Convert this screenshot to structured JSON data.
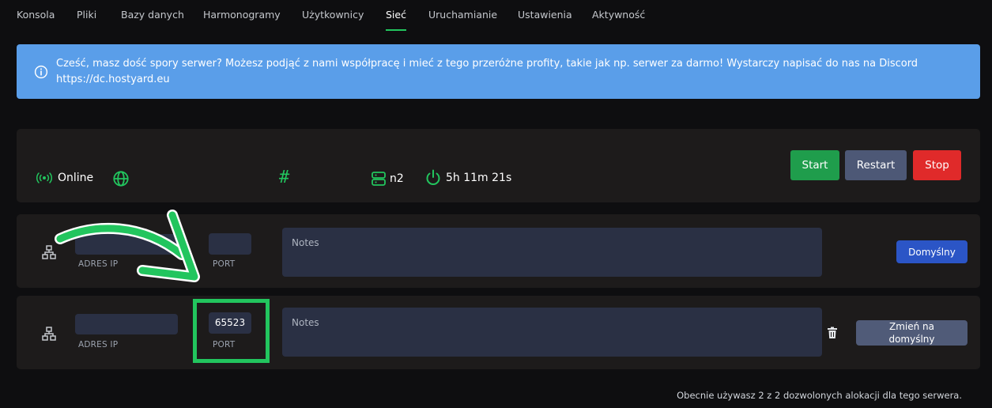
{
  "nav": {
    "items": [
      "Konsola",
      "Pliki",
      "Bazy danych",
      "Harmonogramy",
      "Użytkownicy",
      "Sieć",
      "Uruchamianie",
      "Ustawienia",
      "Aktywność"
    ],
    "active": "Sieć",
    "accent_color": "#22c55e"
  },
  "banner": {
    "icon": "info-circle-icon",
    "text": "Cześć, masz dość spory serwer? Możesz podjąć z nami współpracę i mieć z tego przeróżne profity, takie jak np. serwer za darmo! Wystarczy napisać do nas na Discord https://dc.hostyard.eu",
    "color": "#5a9ee9"
  },
  "status": {
    "state": "Online",
    "node": "n2",
    "uptime": "5h 11m 21s",
    "icons": [
      "broadcast-icon",
      "globe-icon",
      "hash-icon",
      "server-icon",
      "power-icon"
    ],
    "buttons": {
      "start": "Start",
      "restart": "Restart",
      "stop": "Stop"
    },
    "colors": {
      "start": "#1f9d4c",
      "restart": "#4d5876",
      "stop": "#e02a2a"
    }
  },
  "allocations": [
    {
      "ip_value": "",
      "ip_label": "ADRES IP",
      "port_value": "",
      "port_label": "PORT",
      "notes_placeholder": "Notes",
      "action_label": "Domyślny"
    },
    {
      "ip_value": "",
      "ip_label": "ADRES IP",
      "port_value": "65523",
      "port_label": "PORT",
      "notes_placeholder": "Notes",
      "action_label": "Zmień na domyślny"
    }
  ],
  "footer": {
    "text": "Obecnie używasz 2 z 2 dozwolonych alokacji dla tego serwera."
  }
}
